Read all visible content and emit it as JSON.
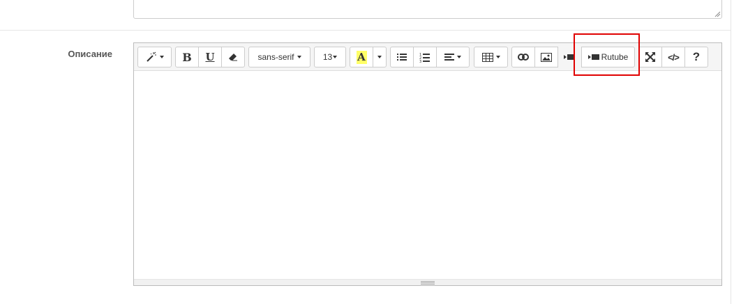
{
  "form": {
    "description_label": "Описание"
  },
  "toolbar": {
    "font_name": "sans-serif",
    "font_size": "13",
    "rutube_label": "Rutube",
    "help_label": "?",
    "codeview_label": "</>",
    "bold_label": "B",
    "underline_label": "U",
    "highlight_label": "A",
    "highlight_color": "#ffff66"
  },
  "annotation": {
    "highlight_color": "#e00000"
  }
}
